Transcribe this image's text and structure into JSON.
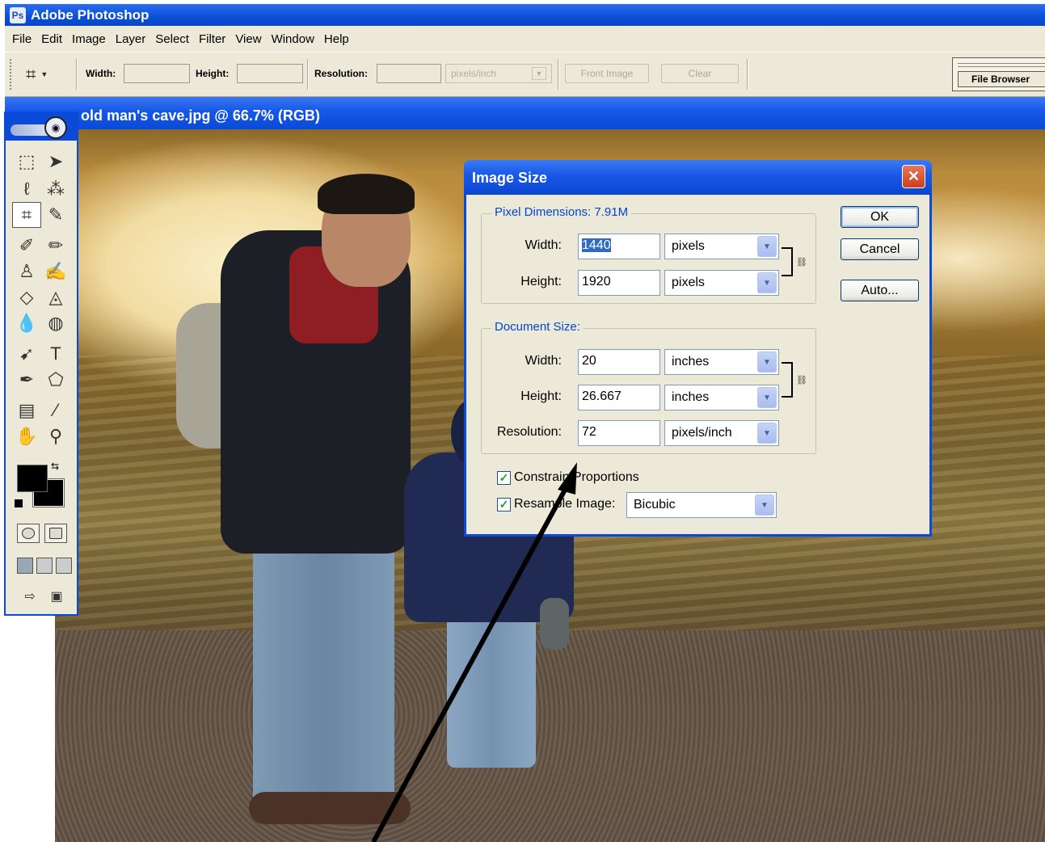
{
  "app": {
    "title": "Adobe Photoshop"
  },
  "menu": [
    "File",
    "Edit",
    "Image",
    "Layer",
    "Select",
    "Filter",
    "View",
    "Window",
    "Help"
  ],
  "options_bar": {
    "width_label": "Width:",
    "height_label": "Height:",
    "resolution_label": "Resolution:",
    "resolution_unit": "pixels/inch",
    "front_image_label": "Front Image",
    "clear_label": "Clear",
    "file_browser_label": "File Browser"
  },
  "document": {
    "title": "old man's cave.jpg @ 66.7% (RGB)"
  },
  "dialog": {
    "title": "Image Size",
    "close_glyph": "✕",
    "pixel_dimensions": {
      "title": "Pixel Dimensions:  7.91M",
      "width_label": "Width:",
      "width_value": "1440",
      "width_unit": "pixels",
      "height_label": "Height:",
      "height_value": "1920",
      "height_unit": "pixels"
    },
    "document_size": {
      "title": "Document Size:",
      "width_label": "Width:",
      "width_value": "20",
      "width_unit": "inches",
      "height_label": "Height:",
      "height_value": "26.667",
      "height_unit": "inches",
      "resolution_label": "Resolution:",
      "resolution_value": "72",
      "resolution_unit": "pixels/inch"
    },
    "constrain_label": "Constrain Proportions",
    "constrain_checked": true,
    "resample_label": "Resample Image:",
    "resample_checked": true,
    "resample_value": "Bicubic",
    "buttons": {
      "ok": "OK",
      "cancel": "Cancel",
      "auto": "Auto..."
    }
  },
  "colors": {
    "title_blue": "#0b4ad8",
    "dialog_face": "#ece9d8",
    "close_red": "#c9401e",
    "group_title_blue": "#0046d5"
  }
}
